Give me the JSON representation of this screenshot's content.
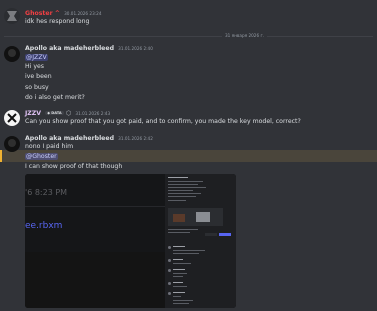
{
  "messages": {
    "m1": {
      "author": "Ghoster",
      "time": "30.01.2026 23:24",
      "lines": [
        "idk hes respond long"
      ],
      "name_color": "#f23f43"
    },
    "divider": "31 января 2026 г.",
    "m2": {
      "author": "Apollo aka madeherbleed",
      "time": "31.01.2026 2:40",
      "mention": "@JZZV",
      "lines": [
        "Hi yes",
        "ive been",
        "so busy",
        "do i also get merit?"
      ],
      "name_color": "#dbdee1"
    },
    "m3": {
      "author": "JZZV",
      "tag": "DATA",
      "time": "31.01.2026 2:43",
      "lines": [
        "Can you show proof that you got paid, and to confirm, you made the key model, correct?"
      ],
      "name_color": "#e0c2f5"
    },
    "m4": {
      "author": "Apollo aka madeherbleed",
      "time": "31.01.2026 2:42",
      "lines": [
        "nono I paid him"
      ],
      "mention": "@Ghoster",
      "after": "I can show proof of that though",
      "name_color": "#dbdee1"
    }
  },
  "attachment": {
    "left_text_1": "'6 8:23 PM",
    "left_text_2": "ee.rbxm"
  }
}
